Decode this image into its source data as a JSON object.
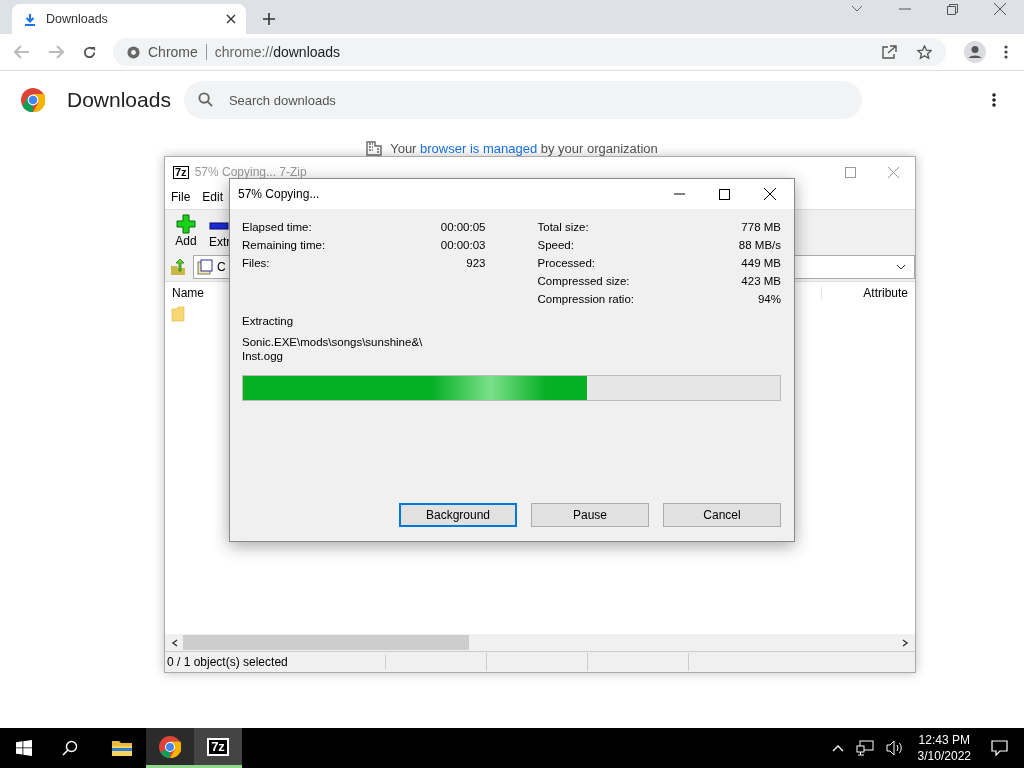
{
  "browser": {
    "tab": {
      "title": "Downloads",
      "selected": true
    },
    "omnibox": {
      "site_label": "Chrome",
      "url_scheme": "chrome://",
      "url_page": "downloads"
    },
    "page": {
      "title": "Downloads",
      "search": {
        "placeholder": "Search downloads"
      },
      "managed_notice": {
        "before": "Your",
        "link": "browser is managed",
        "after": "by your organization"
      }
    }
  },
  "zip_window": {
    "title": "57% Copying... 7-Zip",
    "icon_text": "7z",
    "menu": [
      "File",
      "Edit"
    ],
    "toolbar": [
      "Add",
      "Extr"
    ],
    "address": "C",
    "columns": [
      "Name",
      "Attribute"
    ],
    "status": "0 / 1 object(s) selected"
  },
  "dialog": {
    "title": "57% Copying...",
    "left_stats": [
      {
        "label": "Elapsed time:",
        "value": "00:00:05"
      },
      {
        "label": "Remaining time:",
        "value": "00:00:03"
      },
      {
        "label": "Files:",
        "value": "923"
      }
    ],
    "right_stats": [
      {
        "label": "Total size:",
        "value": "778 MB"
      },
      {
        "label": "Speed:",
        "value": "88 MB/s"
      },
      {
        "label": "Processed:",
        "value": "449 MB"
      },
      {
        "label": "Compressed size:",
        "value": "423 MB"
      },
      {
        "label": "Compression ratio:",
        "value": "94%"
      }
    ],
    "action": "Extracting",
    "file_path": [
      "Sonic.EXE\\mods\\songs\\sunshine&\\",
      "Inst.ogg"
    ],
    "progress": {
      "level": 0.64
    },
    "buttons": [
      {
        "label": "Background",
        "focused": true
      },
      {
        "label": "Pause",
        "focused": false
      },
      {
        "label": "Cancel",
        "focused": false
      }
    ]
  },
  "taskbar": {
    "apps": [
      {
        "kind": "explorer",
        "active": false
      },
      {
        "kind": "chrome",
        "active": true
      },
      {
        "kind": "sevenzip",
        "active": true,
        "icon_text": "7z"
      }
    ],
    "clock": {
      "time": "12:43 PM",
      "date": "3/10/2022"
    }
  }
}
